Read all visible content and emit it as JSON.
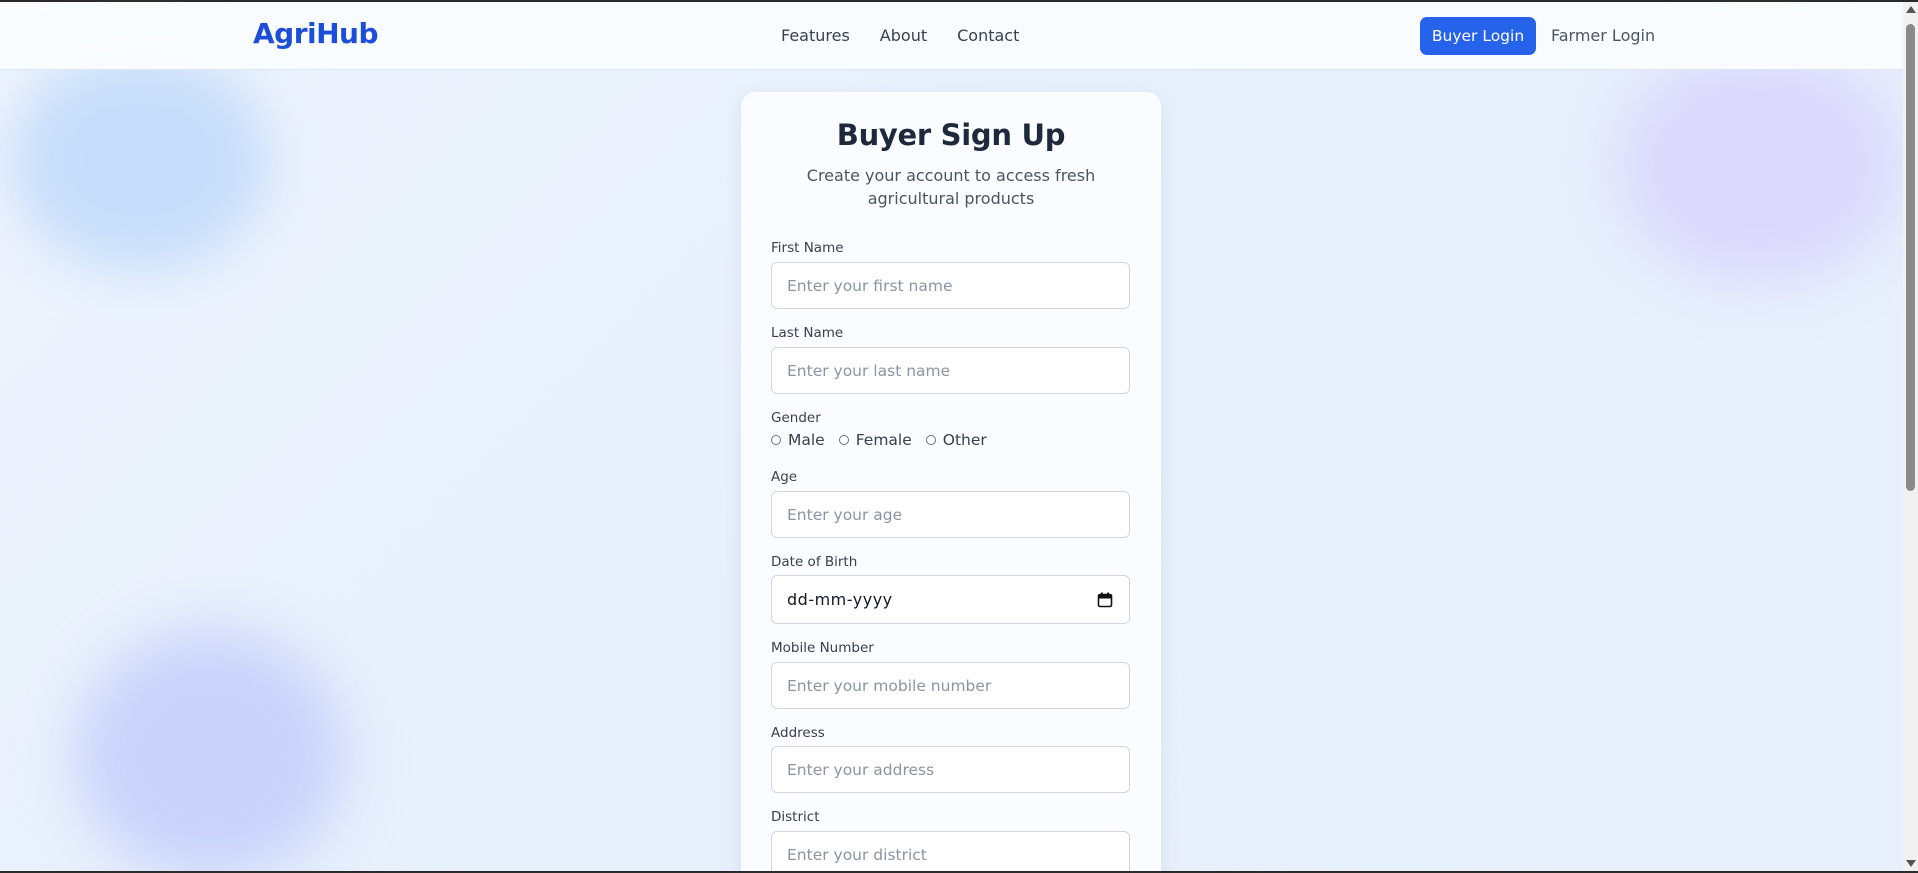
{
  "header": {
    "logo": "AgriHub",
    "nav_links": [
      "Features",
      "About",
      "Contact"
    ],
    "buyer_login_label": "Buyer Login",
    "farmer_login_label": "Farmer Login"
  },
  "form": {
    "title": "Buyer Sign Up",
    "subtitle": "Create your account to access fresh agricultural products",
    "first_name": {
      "label": "First Name",
      "placeholder": "Enter your first name",
      "value": ""
    },
    "last_name": {
      "label": "Last Name",
      "placeholder": "Enter your last name",
      "value": ""
    },
    "gender": {
      "label": "Gender",
      "options": [
        "Male",
        "Female",
        "Other"
      ],
      "selected": null
    },
    "age": {
      "label": "Age",
      "placeholder": "Enter your age",
      "value": ""
    },
    "date_of_birth": {
      "label": "Date of Birth",
      "display": "dd-mm-yyyy",
      "icon": "calendar-icon"
    },
    "mobile": {
      "label": "Mobile Number",
      "placeholder": "Enter your mobile number",
      "value": ""
    },
    "address": {
      "label": "Address",
      "placeholder": "Enter your address",
      "value": ""
    },
    "district": {
      "label": "District",
      "placeholder": "Enter your district",
      "value": ""
    }
  },
  "colors": {
    "brand": "#1d4ed8",
    "primary_button": "#2563eb",
    "page_background": "#eaf2fd"
  }
}
